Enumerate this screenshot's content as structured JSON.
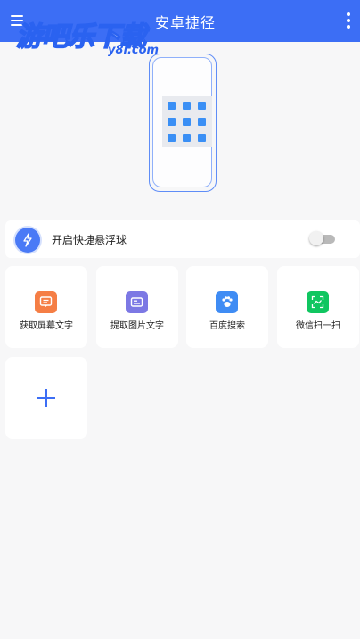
{
  "app": {
    "title": "安卓捷径",
    "accent": "#3c6ef5"
  },
  "watermark": {
    "main": "游吧乐下载",
    "sub": "y8l.com"
  },
  "icons": {
    "menu": "menu-icon",
    "more": "more-vertical-icon",
    "float": "bolt-icon",
    "add": "plus-icon"
  },
  "float_ball": {
    "label": "开启快捷悬浮球",
    "enabled": false
  },
  "shortcuts": [
    {
      "label": "获取屏幕文字",
      "icon": "screen-text-icon",
      "color": "#f57e45"
    },
    {
      "label": "提取图片文字",
      "icon": "image-text-icon",
      "color": "#7c78e4"
    },
    {
      "label": "百度搜索",
      "icon": "baidu-paw-icon",
      "color": "#3f8cf4"
    },
    {
      "label": "微信扫一扫",
      "icon": "wechat-scan-icon",
      "color": "#10c660"
    }
  ]
}
